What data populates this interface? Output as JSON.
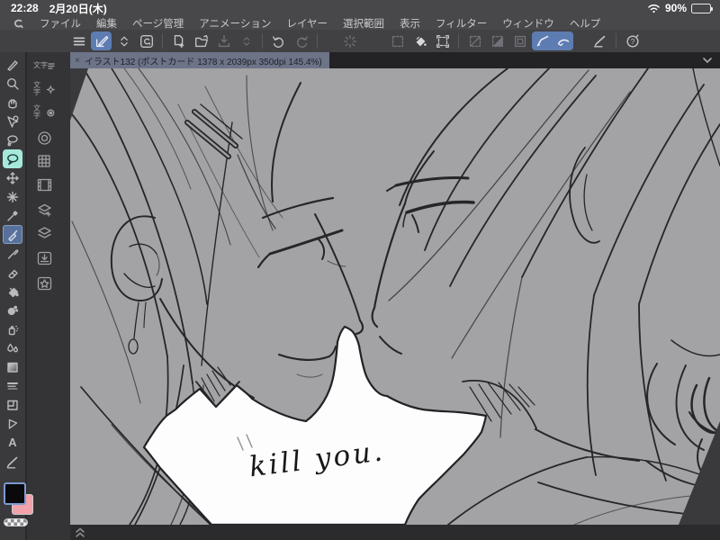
{
  "status_bar": {
    "time": "22:28",
    "date": "2月20日(木)",
    "battery_percent": "90%"
  },
  "menu_bar": {
    "items": [
      "ファイル",
      "編集",
      "ページ管理",
      "アニメーション",
      "レイヤー",
      "選択範囲",
      "表示",
      "フィルター",
      "ウィンドウ",
      "ヘルプ"
    ]
  },
  "toolbar": {
    "help_glyph": "?",
    "icons": [
      "main-menu",
      "edit-canvas",
      "collapse-chevrons",
      "clip-studio-logo",
      "new-file",
      "open-file",
      "save-file",
      "save-chevrons",
      "undo",
      "redo",
      "processing-spinner",
      "select-area",
      "fill-bucket",
      "transform-frame",
      "deselect",
      "invert-selection",
      "selection-border",
      "snap-pen",
      "smooth-brush",
      "correct-line",
      "help"
    ]
  },
  "tab_bar": {
    "close_glyph": "×",
    "active_tab": "イラスト132 (ポストカード 1378 x 2039px 350dpi 145.4%)"
  },
  "sidebar": {
    "text_tool_label": "A",
    "palette_text_label": "文字",
    "tools": [
      "operation-pen",
      "zoom",
      "hand",
      "object",
      "lasso",
      "balloon",
      "move",
      "magic-wand",
      "eyedropper",
      "marker",
      "pen",
      "eraser",
      "fill-bucket",
      "ink-blob",
      "airbrush",
      "blend-drops",
      "gradient",
      "stream-line",
      "frame-border",
      "figure-flag",
      "text",
      "line-correct"
    ],
    "palettes": [
      "subtool-text",
      "tool-property-text",
      "brush-size-text",
      "color-wheel",
      "color-set",
      "material",
      "layer-property",
      "layers",
      "download",
      "favorites"
    ]
  },
  "canvas": {
    "annotation": "kill you."
  },
  "bottom_bar": {
    "expand_icon": "double-chevron-up"
  },
  "colors": {
    "accent_blue": "#5d7cb2",
    "tool_selected": "#57709c",
    "tool_teal": "#a6e8dc",
    "foreground_chip": "#0a0a0d",
    "background_chip": "#f2a2aa",
    "canvas_gray": "#a3a3a5",
    "pasteboard": "#3a3a3d",
    "paper_white": "#fdfdfd",
    "ink": "#26262a"
  }
}
